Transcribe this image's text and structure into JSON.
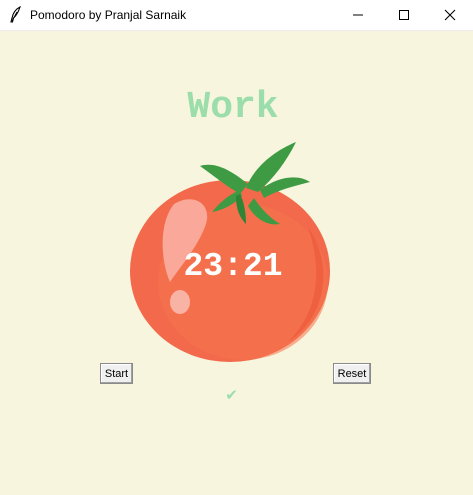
{
  "window": {
    "title": "Pomodoro by Pranjal Sarnaik",
    "icon": "feather-icon",
    "controls": [
      "minimize-icon",
      "maximize-icon",
      "close-icon"
    ]
  },
  "main": {
    "heading": "Work",
    "timer": "23:21",
    "checkmarks": "✔",
    "image": "tomato-image"
  },
  "buttons": {
    "start_label": "Start",
    "reset_label": "Reset"
  },
  "colors": {
    "background": "#f7f5dd",
    "heading": "#9bdeac",
    "tomato": "#f26a4b",
    "leaf": "#3e9b44",
    "timer_text": "#ffffff"
  }
}
